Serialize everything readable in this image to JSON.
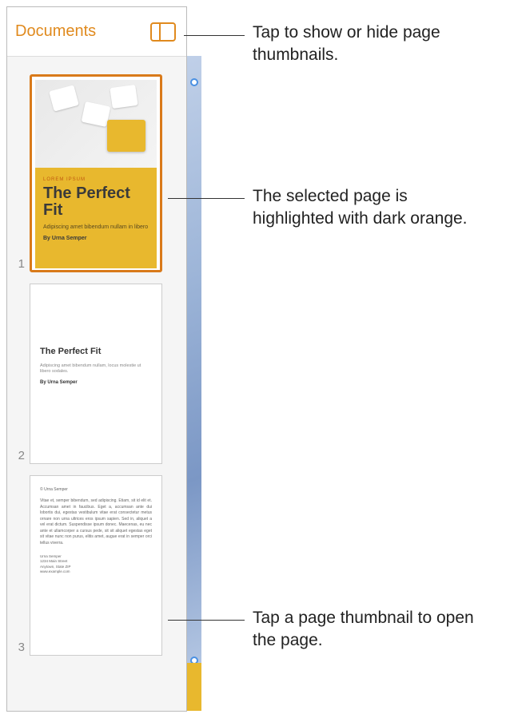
{
  "header": {
    "title": "Documents"
  },
  "pages": [
    {
      "number": "1",
      "eyebrow": "LOREM IPSUM",
      "title": "The Perfect Fit",
      "subtitle": "Adipiscing amet bibendum nullam in libero",
      "author": "By Urna Semper"
    },
    {
      "number": "2",
      "title": "The Perfect Fit",
      "text": "Adipiscing amet bibendum nullam, locus molestie ut libero sodales.",
      "author": "By Urna Semper"
    },
    {
      "number": "3",
      "byline": "© Urna Semper",
      "body": "Vitae et, semper bibendum, sed adipiscing. Etiam, sit id elit et. Accumsan amet in faucibus. Eget a, accumsan ante dui lobortis dui, egestas vestibulum vitae erat consectetur metus ornare non urna ultrices eros ipsum sapien. Sed in, aliquet a vel erat dictum. Suspendisse ipsum donec. Maecenas, eu nec ante et ullamcorper a cursus pede, sit sit aliquet egestas eget sit vitae nunc non purus, elitis amet, augue erat in semper orci tellus viverra.",
      "addr1": "Urna Semper",
      "addr2": "1234 Main Street",
      "addr3": "Anytown, State ZIP",
      "addr4": "www.example.com"
    }
  ],
  "callouts": {
    "toggle": "Tap to show or hide page thumbnails.",
    "selected": "The selected page is highlighted with dark orange.",
    "open": "Tap a page thumbnail to open the page."
  }
}
